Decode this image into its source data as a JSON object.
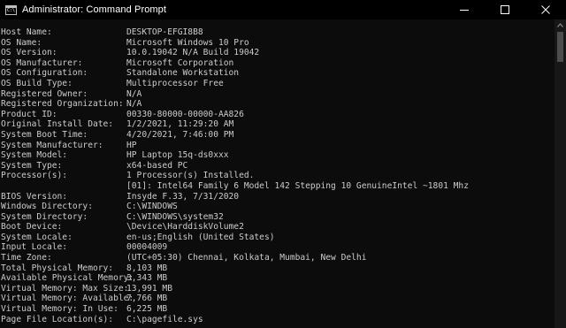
{
  "window": {
    "title": "Administrator: Command Prompt",
    "icon_text": "C:\\"
  },
  "controls": {
    "minimize_icon": "minimize-icon",
    "maximize_icon": "maximize-icon",
    "close_icon": "close-icon"
  },
  "console": {
    "rows": [
      {
        "label": "Host Name:",
        "value": "DESKTOP-EFGI8B8"
      },
      {
        "label": "OS Name:",
        "value": "Microsoft Windows 10 Pro"
      },
      {
        "label": "OS Version:",
        "value": "10.0.19042 N/A Build 19042"
      },
      {
        "label": "OS Manufacturer:",
        "value": "Microsoft Corporation"
      },
      {
        "label": "OS Configuration:",
        "value": "Standalone Workstation"
      },
      {
        "label": "OS Build Type:",
        "value": "Multiprocessor Free"
      },
      {
        "label": "Registered Owner:",
        "value": "N/A"
      },
      {
        "label": "Registered Organization:",
        "value": "N/A"
      },
      {
        "label": "Product ID:",
        "value": "00330-80000-00000-AA826"
      },
      {
        "label": "Original Install Date:",
        "value": "1/2/2021, 11:29:20 AM"
      },
      {
        "label": "System Boot Time:",
        "value": "4/20/2021, 7:46:00 PM"
      },
      {
        "label": "System Manufacturer:",
        "value": "HP"
      },
      {
        "label": "System Model:",
        "value": "HP Laptop 15q-ds0xxx"
      },
      {
        "label": "System Type:",
        "value": "x64-based PC"
      },
      {
        "label": "Processor(s):",
        "value": "1 Processor(s) Installed."
      },
      {
        "label": "",
        "value": "[01]: Intel64 Family 6 Model 142 Stepping 10 GenuineIntel ~1801 Mhz"
      },
      {
        "label": "BIOS Version:",
        "value": "Insyde F.33, 7/31/2020"
      },
      {
        "label": "Windows Directory:",
        "value": "C:\\WINDOWS"
      },
      {
        "label": "System Directory:",
        "value": "C:\\WINDOWS\\system32"
      },
      {
        "label": "Boot Device:",
        "value": "\\Device\\HarddiskVolume2"
      },
      {
        "label": "System Locale:",
        "value": "en-us;English (United States)"
      },
      {
        "label": "Input Locale:",
        "value": "00004009"
      },
      {
        "label": "Time Zone:",
        "value": "(UTC+05:30) Chennai, Kolkata, Mumbai, New Delhi"
      },
      {
        "label": "Total Physical Memory:",
        "value": "8,103 MB"
      },
      {
        "label": "Available Physical Memory:",
        "value": "3,343 MB"
      },
      {
        "label": "Virtual Memory: Max Size:",
        "value": "13,991 MB"
      },
      {
        "label": "Virtual Memory: Available:",
        "value": "7,766 MB"
      },
      {
        "label": "Virtual Memory: In Use:",
        "value": "6,225 MB"
      },
      {
        "label": "Page File Location(s):",
        "value": "C:\\pagefile.sys"
      }
    ]
  },
  "colors": {
    "background": "#0c0c0c",
    "titlebar": "#000000",
    "text": "#cccccc",
    "scrollbar_track": "#171717",
    "scrollbar_thumb": "#4d4d4d"
  }
}
